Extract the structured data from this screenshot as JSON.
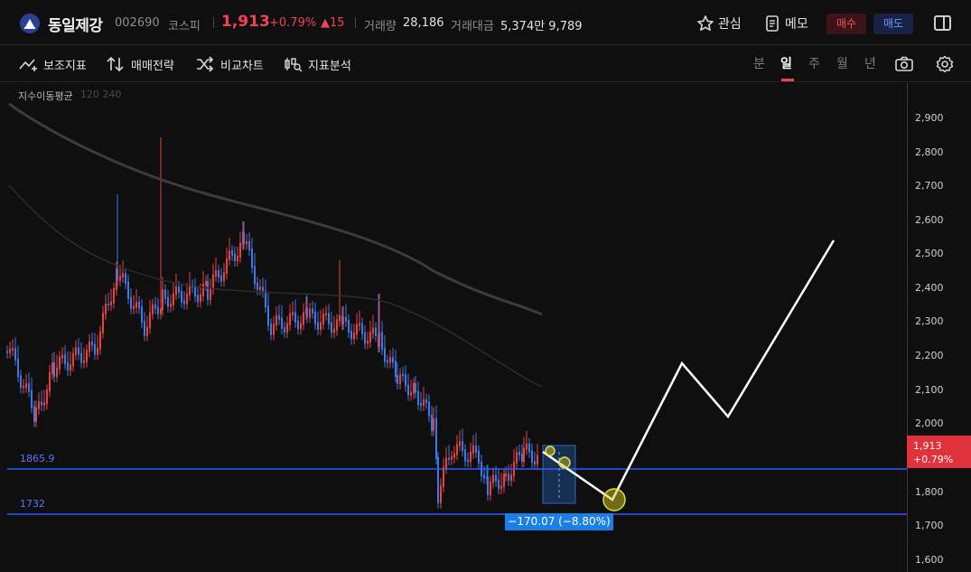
{
  "header": {
    "stock_name": "동일제강",
    "stock_code": "002690",
    "market": "코스피",
    "price": "1,913",
    "change_pct": "+0.79%",
    "change_abs": "▲15",
    "volume_label": "거래량",
    "volume_value": "28,186",
    "turnover_label": "거래대금",
    "turnover_value": "5,374만 9,789",
    "watch_label": "관심",
    "memo_label": "메모",
    "buy_label": "매수",
    "sell_label": "매도"
  },
  "toolbar": {
    "tools": [
      "보조지표",
      "매매전략",
      "비교차트",
      "지표분석"
    ],
    "periods": [
      "분",
      "일",
      "주",
      "월",
      "년"
    ],
    "active_period": "일"
  },
  "chart": {
    "indicator_label": "지수이동평균",
    "indicator_params": "120 240",
    "y_ticks": [
      "2,900",
      "2,800",
      "2,700",
      "2,600",
      "2,500",
      "2,400",
      "2,300",
      "2,200",
      "2,100",
      "2,000",
      "1,800",
      "1,700",
      "1,600"
    ],
    "current_price": "1,913",
    "current_change": "+0.79%",
    "support_high": "1865.9",
    "support_low": "1732",
    "measure_text": "−170.07 (−8.80%)",
    "colors": {
      "up": "#e8413e",
      "down": "#3b7ae8",
      "level": "#3058ff",
      "tag": "#e0323c"
    }
  }
}
